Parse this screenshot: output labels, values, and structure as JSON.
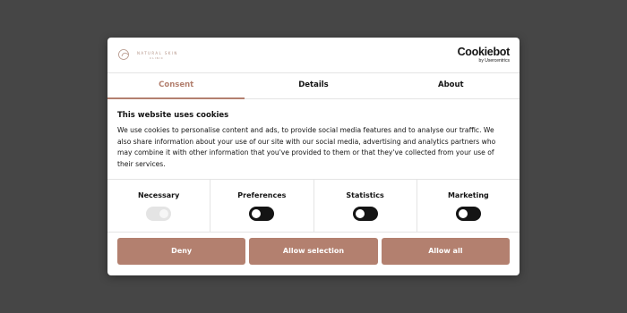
{
  "brand": {
    "logo_text": "NATURAL SKIN",
    "logo_subtext": "CLINIC",
    "cookiebot_name": "Cookiebot",
    "cookiebot_tagline": "by Usercentrics"
  },
  "tabs": [
    {
      "label": "Consent",
      "active": true
    },
    {
      "label": "Details",
      "active": false
    },
    {
      "label": "About",
      "active": false
    }
  ],
  "content": {
    "title": "This website uses cookies",
    "body": "We use cookies to personalise content and ads, to provide social media features and to analyse our traffic. We also share information about your use of our site with our social media, advertising and analytics partners who may combine it with other information that you've provided to them or that they've collected from your use of their services."
  },
  "categories": [
    {
      "label": "Necessary",
      "state": "on-disabled"
    },
    {
      "label": "Preferences",
      "state": "off"
    },
    {
      "label": "Statistics",
      "state": "off"
    },
    {
      "label": "Marketing",
      "state": "off"
    }
  ],
  "buttons": {
    "deny": "Deny",
    "allow_selection": "Allow selection",
    "allow_all": "Allow all"
  },
  "colors": {
    "accent": "#b3806f",
    "overlay": "#464646",
    "toggle_off": "#141414"
  }
}
